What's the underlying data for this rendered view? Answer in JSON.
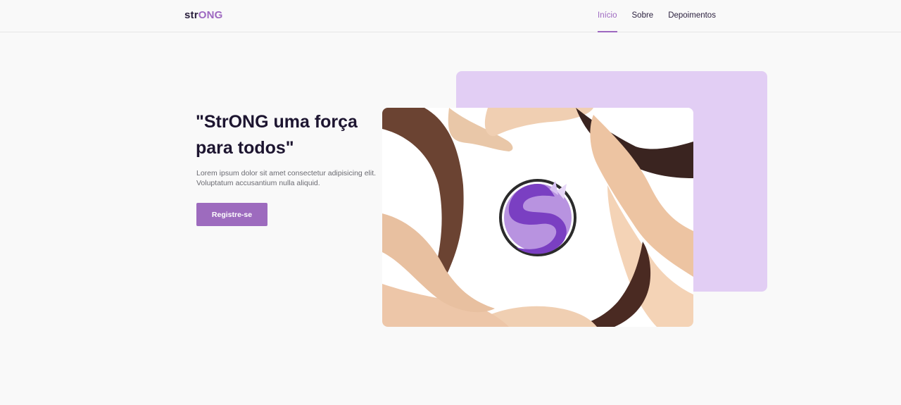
{
  "header": {
    "logo_prefix": "str",
    "logo_accent": "ONG",
    "nav": [
      {
        "label": "Início",
        "active": true
      },
      {
        "label": "Sobre",
        "active": false
      },
      {
        "label": "Depoimentos",
        "active": false
      }
    ]
  },
  "hero": {
    "title": "\"StrONG uma força para todos\"",
    "description": "Lorem ipsum dolor sit amet consectetur adipisicing elit. Voluptatum accusantium nulla aliquid.",
    "cta_label": "Registre-se"
  },
  "image": {
    "icon": "hands-circle-with-fox-logo",
    "logo_letter": "S"
  },
  "colors": {
    "accent": "#9d68c0",
    "card_bg": "#e2cef4",
    "page_bg": "#f9f9f9"
  }
}
